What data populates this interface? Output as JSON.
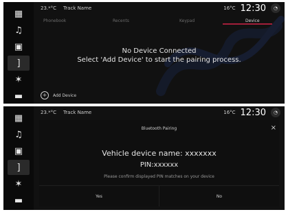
{
  "rail": {
    "items": [
      {
        "icon": "grid-icon",
        "glyph": "▦"
      },
      {
        "icon": "music-icon",
        "glyph": "♫"
      },
      {
        "icon": "phone-device-icon",
        "glyph": "▣"
      },
      {
        "icon": "bracket-icon",
        "glyph": "]"
      },
      {
        "icon": "fan-icon",
        "glyph": "✶"
      },
      {
        "icon": "car-icon",
        "glyph": "▬"
      }
    ],
    "active_index": 3
  },
  "status_top": {
    "temp": "23.*°C",
    "track": "Track Name",
    "weather": "16°C",
    "time": "12:30"
  },
  "tabs": [
    "Phonebook",
    "Recents",
    "Keypad",
    "Device"
  ],
  "panel1": {
    "message_line1": "No Device Connected",
    "message_line2": "Select 'Add Device' to start the pairing process.",
    "add_device_label": "Add Device"
  },
  "dialog": {
    "title": "Bluetooth Pairing",
    "vehicle_name": "Vehicle device name: xxxxxxx",
    "pin": "PIN:xxxxxx",
    "note": "Please confirm displayed PIN matches on your device",
    "yes": "Yes",
    "no": "No",
    "close": "×"
  },
  "colors": {
    "accent": "#a31f3a",
    "bg": "#111111"
  }
}
